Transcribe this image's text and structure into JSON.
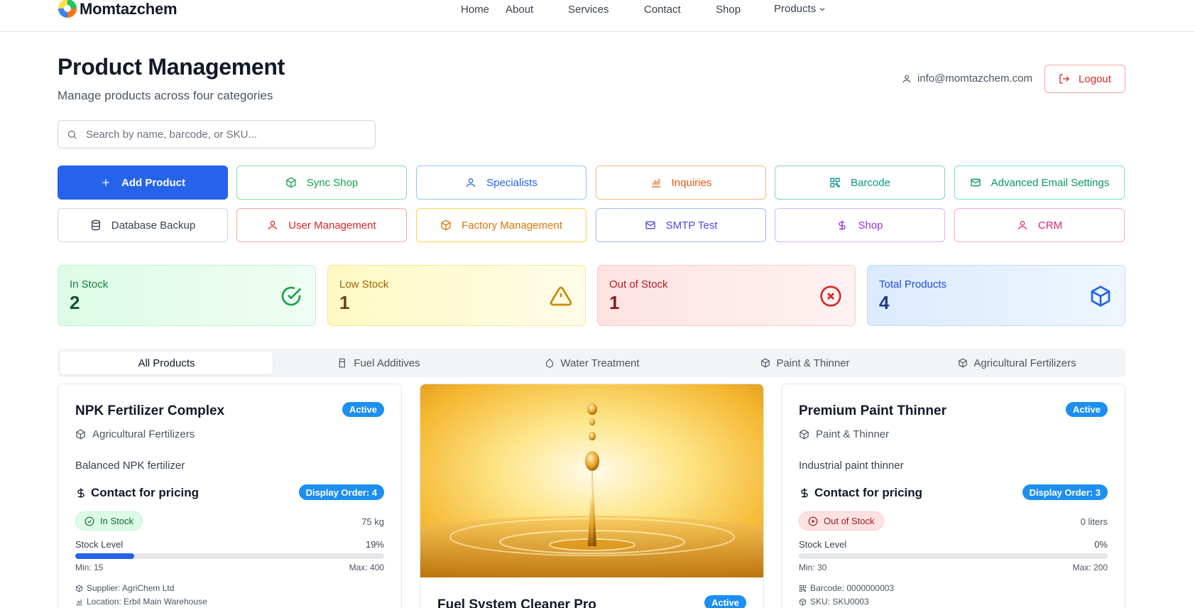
{
  "nav": {
    "brand": "Momtazchem",
    "links": [
      "Home",
      "About",
      "Services",
      "Contact",
      "Shop"
    ],
    "products_label": "Products"
  },
  "header": {
    "title": "Product Management",
    "subtitle": "Manage products across four categories",
    "user_email": "info@momtazchem.com",
    "logout_label": "Logout"
  },
  "search": {
    "placeholder": "Search by name, barcode, or SKU..."
  },
  "actions": [
    {
      "label": "Add Product",
      "icon": "plus-icon",
      "color": "#2563eb"
    },
    {
      "label": "Sync Shop",
      "icon": "package-icon",
      "color": "#16a34a"
    },
    {
      "label": "Specialists",
      "icon": "user-icon",
      "color": "#2563eb"
    },
    {
      "label": "Inquiries",
      "icon": "bar-chart-icon",
      "color": "#ea580c"
    },
    {
      "label": "Barcode",
      "icon": "qr-code-icon",
      "color": "#0d9488"
    },
    {
      "label": "Advanced Email Settings",
      "icon": "mail-icon",
      "color": "#059669"
    },
    {
      "label": "Database Backup",
      "icon": "database-icon",
      "color": "#374151"
    },
    {
      "label": "User Management",
      "icon": "user-icon",
      "color": "#dc2626"
    },
    {
      "label": "Factory Management",
      "icon": "package-icon",
      "color": "#d97706"
    },
    {
      "label": "SMTP Test",
      "icon": "mail-icon",
      "color": "#4f46e5"
    },
    {
      "label": "Shop",
      "icon": "dollar-icon",
      "color": "#9333ea"
    },
    {
      "label": "CRM",
      "icon": "user-icon",
      "color": "#db2777"
    }
  ],
  "stats": [
    {
      "label": "In Stock",
      "value": "2",
      "color": "#16a34a"
    },
    {
      "label": "Low Stock",
      "value": "1",
      "color": "#ca8a04"
    },
    {
      "label": "Out of Stock",
      "value": "1",
      "color": "#dc2626"
    },
    {
      "label": "Total Products",
      "value": "4",
      "color": "#2563eb"
    }
  ],
  "tabs": [
    "All Products",
    "Fuel Additives",
    "Water Treatment",
    "Paint & Thinner",
    "Agricultural Fertilizers"
  ],
  "products": [
    {
      "name": "NPK Fertilizer Complex",
      "status": "Active",
      "category": "Agricultural Fertilizers",
      "description": "Balanced NPK fertilizer",
      "price": "Contact for pricing",
      "display_order": "Display Order: 4",
      "stock_status": "In Stock",
      "quantity": "75 kg",
      "stock_level_label": "Stock Level",
      "stock_percent_text": "19%",
      "stock_fraction": 0.19,
      "min": "Min: 15",
      "max": "Max: 400",
      "meta": [
        "Supplier: AgriChem Ltd",
        "Location: Erbil Main Warehouse"
      ]
    },
    {
      "name": "Fuel System Cleaner Pro",
      "status": "Active"
    },
    {
      "name": "Premium Paint Thinner",
      "status": "Active",
      "category": "Paint & Thinner",
      "description": "Industrial paint thinner",
      "price": "Contact for pricing",
      "display_order": "Display Order: 3",
      "stock_status": "Out of Stock",
      "quantity": "0 liters",
      "stock_level_label": "Stock Level",
      "stock_percent_text": "0%",
      "stock_fraction": 0,
      "min": "Min: 30",
      "max": "Max: 200",
      "meta": [
        "Barcode: 0000000003",
        "SKU: SKU0003"
      ]
    }
  ]
}
